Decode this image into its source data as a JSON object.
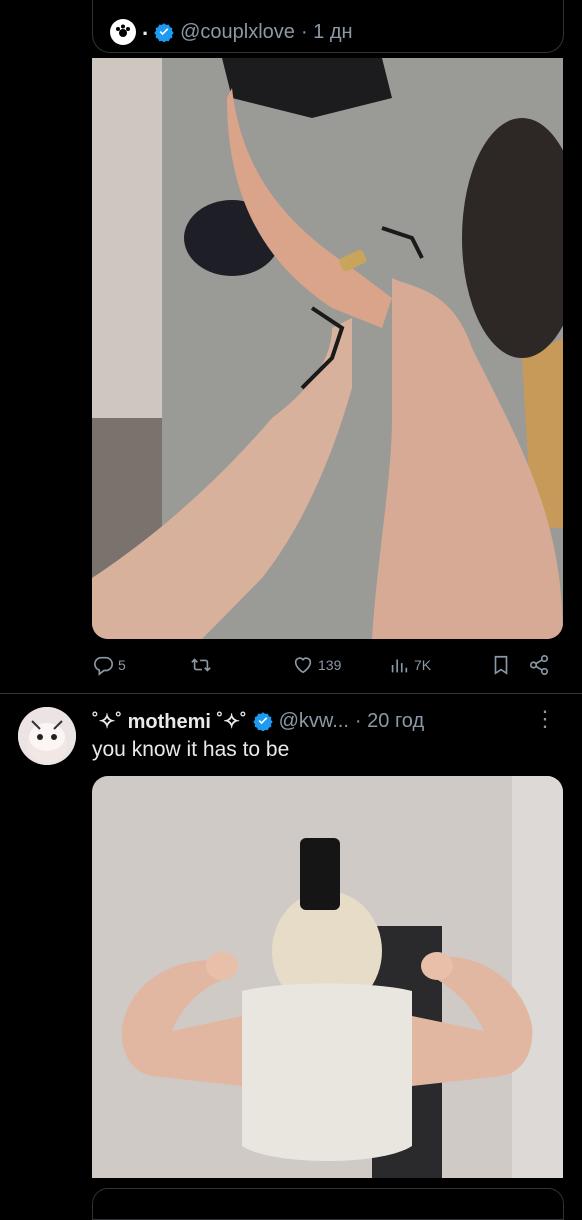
{
  "quoted_tweet": {
    "display_name": ".",
    "handle": "@couplxlove",
    "time": "· 1 дн",
    "verified": true,
    "media_description_icon": "photo"
  },
  "actions": {
    "replies": "5",
    "retweets": "",
    "likes": "139",
    "views": "7K"
  },
  "tweet": {
    "display_name": "˚✧˚ mothemi ˚✧˚",
    "handle": "@kvw...",
    "time": "· 20 год",
    "text": "you know it has to be",
    "verified": true
  },
  "colors": {
    "background": "#000000",
    "text": "#e7e9ea",
    "muted": "#8b98a5",
    "verified": "#1d9bf0",
    "border": "#2f3336"
  }
}
